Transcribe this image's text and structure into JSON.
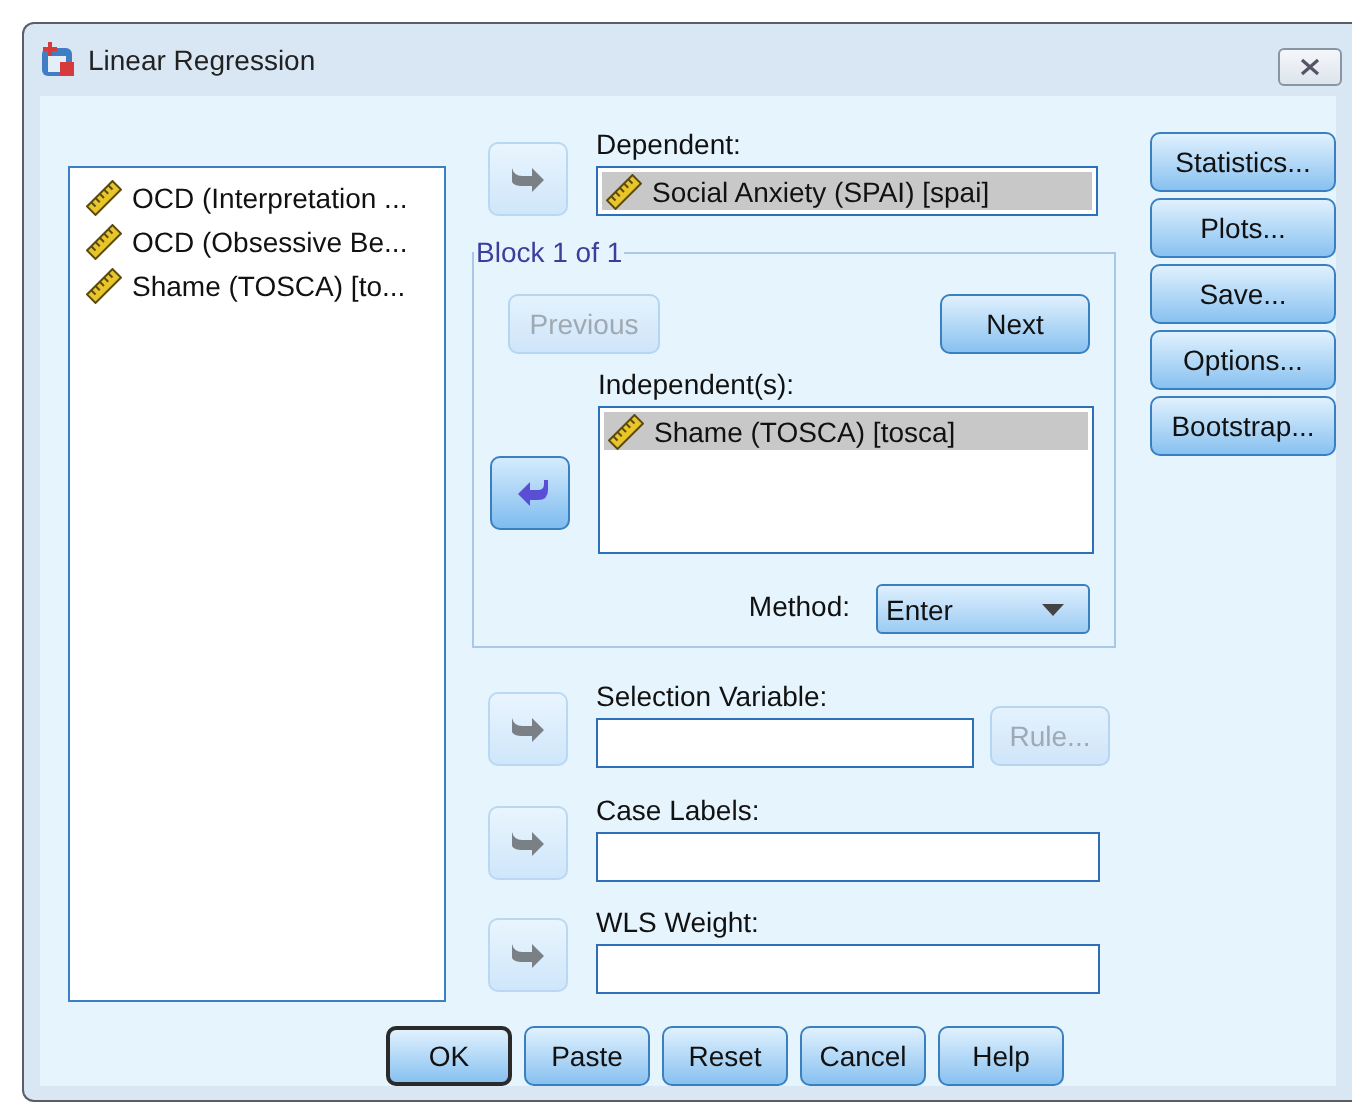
{
  "window": {
    "title": "Linear Regression"
  },
  "variables": [
    {
      "label": "OCD (Interpretation ..."
    },
    {
      "label": "OCD (Obsessive Be..."
    },
    {
      "label": "Shame (TOSCA) [to..."
    }
  ],
  "dependent": {
    "label": "Dependent:",
    "arrow": {
      "kind": "right",
      "disabled": true
    },
    "items": [
      {
        "label": "Social Anxiety (SPAI) [spai]",
        "selected": true
      }
    ]
  },
  "block": {
    "title": "Block 1 of 1",
    "previous": {
      "label": "Previous",
      "disabled": true
    },
    "next": {
      "label": "Next",
      "disabled": false
    },
    "independent": {
      "label": "Independent(s):",
      "arrow": {
        "kind": "left",
        "disabled": false
      },
      "items": [
        {
          "label": "Shame (TOSCA) [tosca]",
          "selected": true
        }
      ]
    },
    "method": {
      "label": "Method:",
      "value": "Enter"
    }
  },
  "selection_variable": {
    "label": "Selection Variable:",
    "arrow": {
      "kind": "right",
      "disabled": true
    },
    "rule": {
      "label": "Rule...",
      "disabled": true
    }
  },
  "case_labels": {
    "label": "Case Labels:",
    "arrow": {
      "kind": "right",
      "disabled": true
    }
  },
  "wls_weight": {
    "label": "WLS Weight:",
    "arrow": {
      "kind": "right",
      "disabled": true
    }
  },
  "side_buttons": [
    {
      "label": "Statistics..."
    },
    {
      "label": "Plots..."
    },
    {
      "label": "Save..."
    },
    {
      "label": "Options..."
    },
    {
      "label": "Bootstrap..."
    }
  ],
  "buttons": [
    {
      "label": "OK",
      "default": true
    },
    {
      "label": "Paste",
      "default": false
    },
    {
      "label": "Reset",
      "default": false
    },
    {
      "label": "Cancel",
      "default": false
    },
    {
      "label": "Help",
      "default": false
    }
  ]
}
